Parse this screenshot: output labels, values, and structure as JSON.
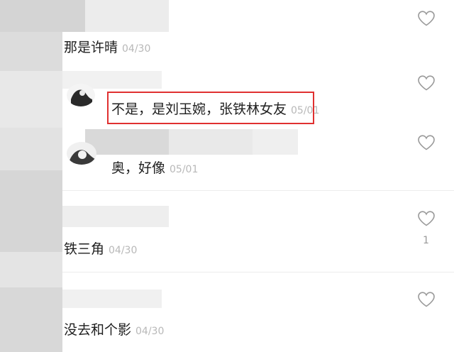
{
  "comments": [
    {
      "text": "那是许晴",
      "time": "04/30",
      "likes": ""
    },
    {
      "text": "不是，是刘玉婉，张铁林女友",
      "time": "05/01",
      "likes": ""
    },
    {
      "text": "奥，好像",
      "time": "05/01",
      "likes": ""
    },
    {
      "text": "铁三角",
      "time": "04/30",
      "likes": "1"
    },
    {
      "text": "没去和个影",
      "time": "04/30",
      "likes": ""
    }
  ],
  "colors": {
    "highlight_border": "#e03030",
    "text": "#1f1f1f",
    "timestamp": "#b8b8b8",
    "heart_stroke": "#9a9a9a"
  },
  "icons": {
    "like": "heart-icon"
  }
}
